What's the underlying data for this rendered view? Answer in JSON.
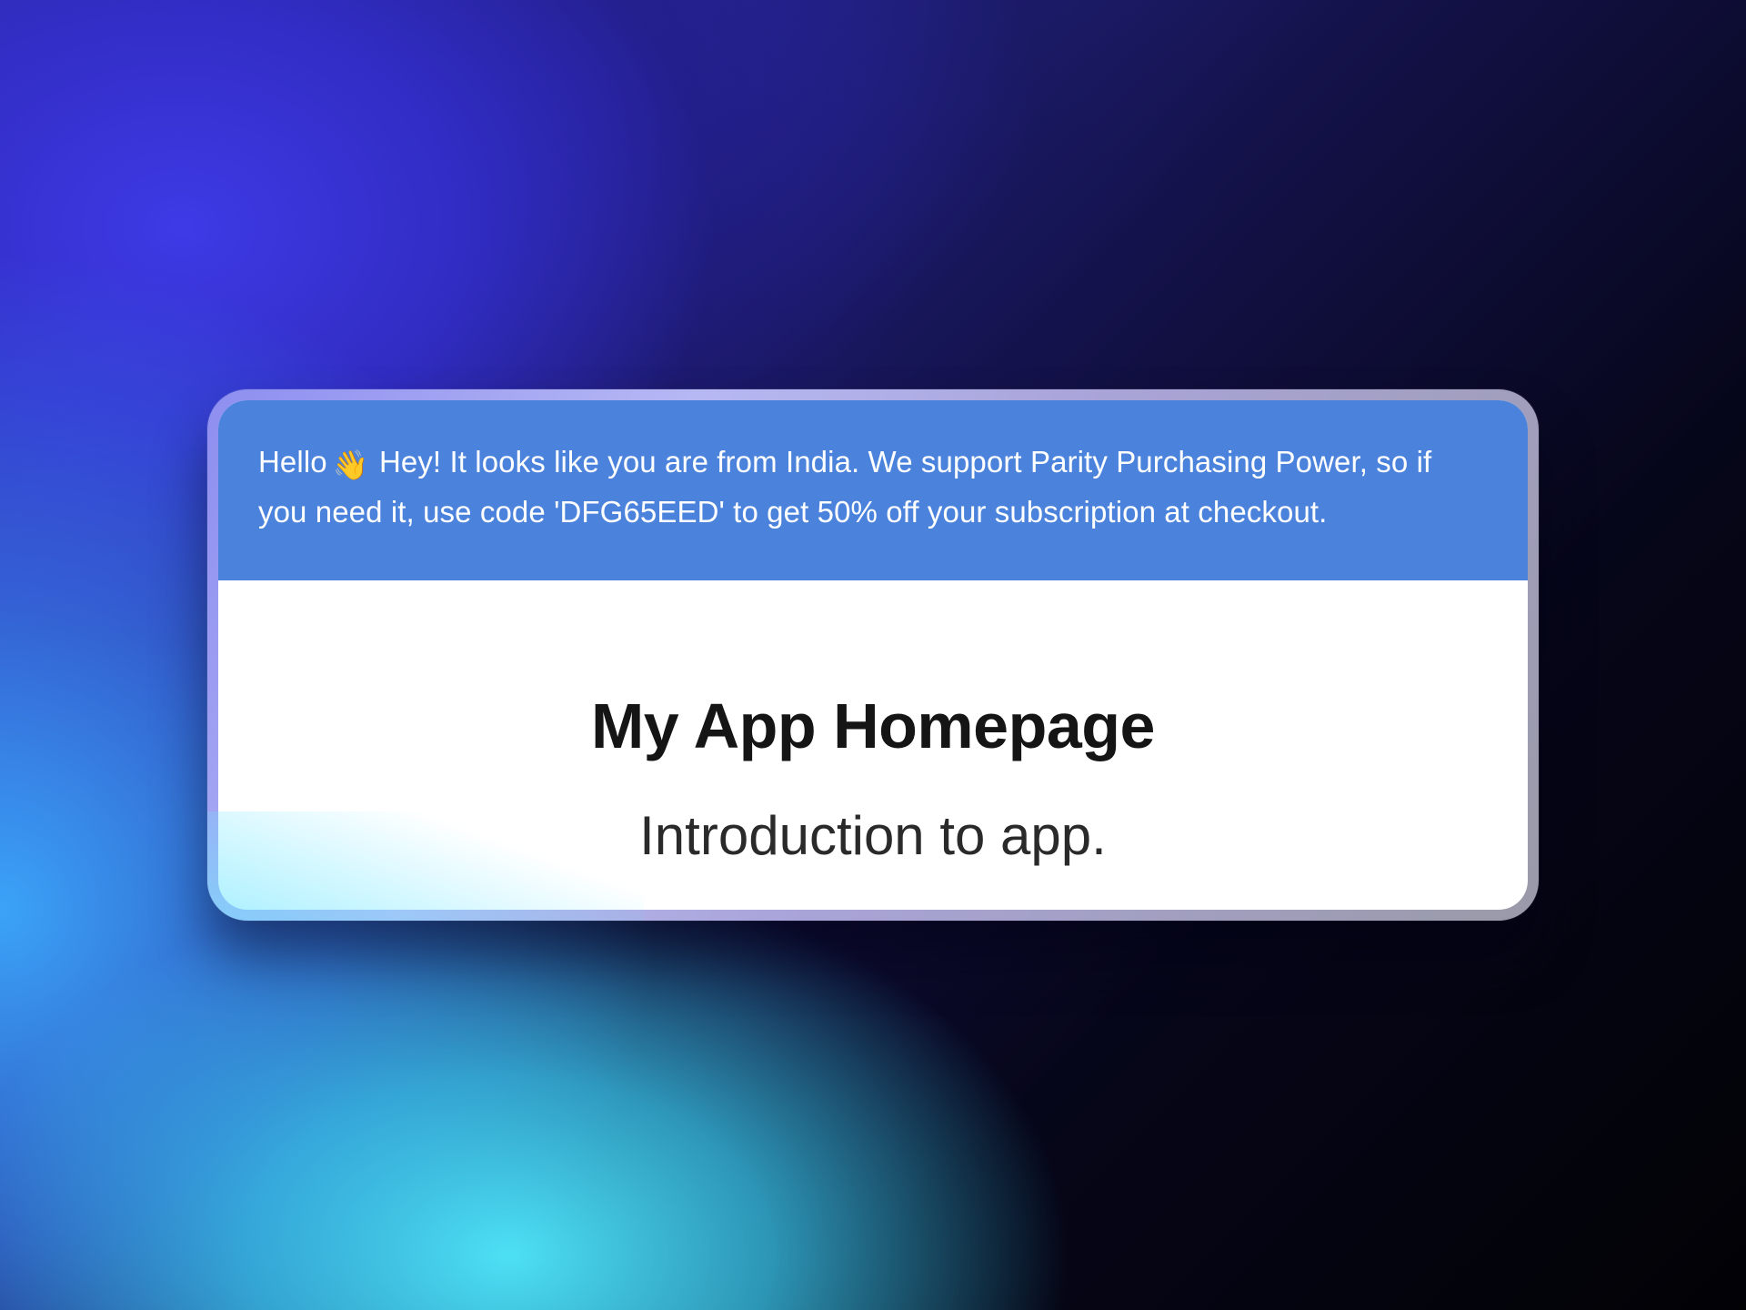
{
  "banner": {
    "greeting": "Hello",
    "icon": "👋",
    "icon_name": "waving-hand-icon",
    "message": "Hey! It looks like you are from India. We support Parity Purchasing Power, so if you need it, use code 'DFG65EED' to get 50% off your subscription at checkout.",
    "background_color": "#4b83dc"
  },
  "main": {
    "title": "My App Homepage",
    "subtitle": "Introduction to app."
  }
}
